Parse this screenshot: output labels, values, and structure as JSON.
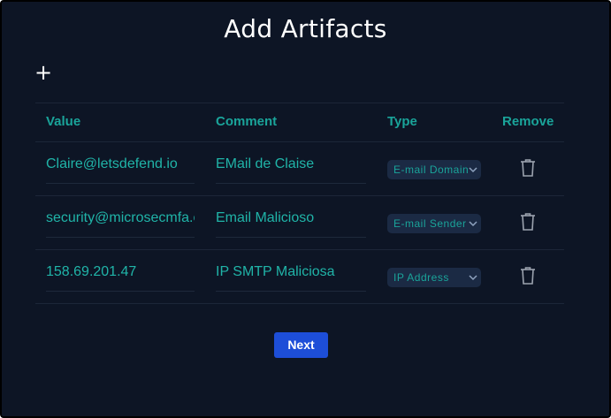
{
  "modal": {
    "title": "Add Artifacts",
    "add_icon": "plus-icon",
    "next_label": "Next"
  },
  "table": {
    "headers": {
      "value": "Value",
      "comment": "Comment",
      "type": "Type",
      "remove": "Remove"
    },
    "rows": [
      {
        "value": "Claire@letsdefend.io",
        "comment": "EMail de Claise",
        "type": "E-mail Domain",
        "remove_icon": "trash-icon"
      },
      {
        "value": " security@microsecmfa.com",
        "comment": "Email Malicioso",
        "type": "E-mail Sender",
        "remove_icon": "trash-icon"
      },
      {
        "value": "158.69.201.47",
        "comment": "IP SMTP Maliciosa",
        "type": "IP Address",
        "remove_icon": "trash-icon"
      }
    ]
  },
  "colors": {
    "background": "#0d1525",
    "accent": "#1aa49a",
    "button": "#1d4ed8",
    "select_bg": "#1b2a44"
  }
}
